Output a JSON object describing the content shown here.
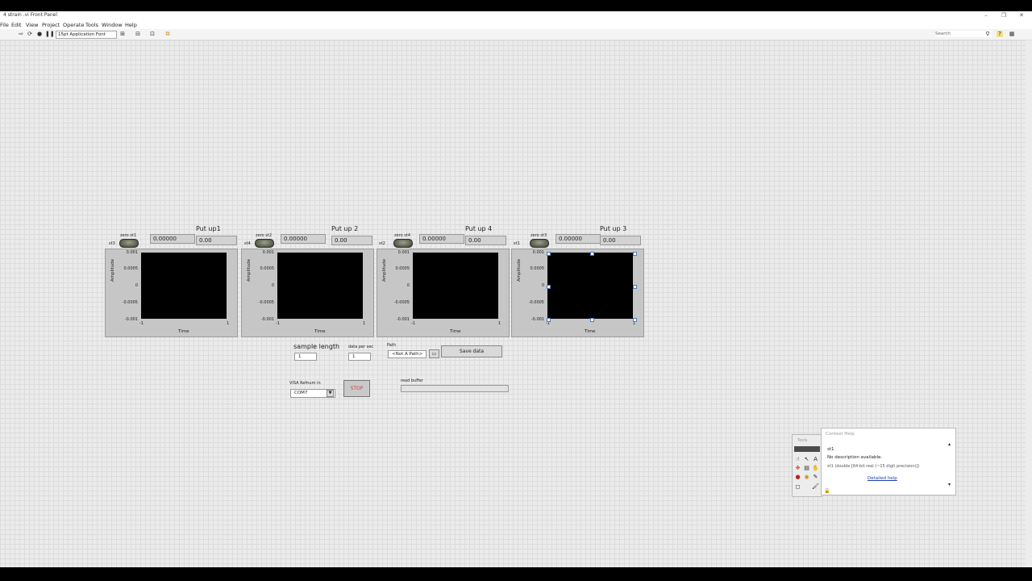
{
  "window": {
    "title": "4 strain .vi Front Panel",
    "minimize_icon": "minimize-icon",
    "restore_icon": "restore-icon",
    "close_icon": "close-icon"
  },
  "menu": [
    "File",
    "Edit",
    "View",
    "Project",
    "Operate",
    "Tools",
    "Window",
    "Help"
  ],
  "toolbar": {
    "font": "15pt Application Font",
    "search_placeholder": "Search",
    "icons": [
      "run-arrow-icon",
      "run-continuously-icon",
      "abort-icon",
      "pause-icon",
      "text-settings-icon",
      "align-icon",
      "distribute-icon",
      "resize-icon",
      "reorder-icon"
    ]
  },
  "panels": [
    {
      "toggle_label": "zero st1",
      "side_label": "st3",
      "reading": "0.00000",
      "title": "Put up1",
      "value": "0.00"
    },
    {
      "toggle_label": "zero st2",
      "side_label": "st4",
      "reading": "0.00000",
      "title": "Put up 2",
      "value": "0.00"
    },
    {
      "toggle_label": "zero st4",
      "side_label": "st2",
      "reading": "0.00000",
      "title": "Put up 4",
      "value": "0.00"
    },
    {
      "toggle_label": "zero st3",
      "side_label": "st1",
      "reading": "0.00000",
      "title": "Put up 3",
      "value": "0.00"
    }
  ],
  "graph_axes": {
    "y_ticks": [
      "0.001",
      "0.0005",
      "0",
      "-0.0005",
      "-0.001"
    ],
    "x_ticks": [
      "-1",
      "1"
    ],
    "ylabel": "Amplitude",
    "xlabel": "Time"
  },
  "controls": {
    "sample_length_label": "sample length",
    "sample_length_value": "1",
    "data_per_sec_label": "data per sec",
    "data_per_sec_value": "1",
    "path_label": "Path",
    "path_value": "<Not A Path>",
    "save_button": "Save data",
    "visa_label": "VISA Refnum in",
    "visa_value": "COM7",
    "stop_button": "STOP",
    "read_buffer_label": "read buffer",
    "read_buffer_value": ""
  },
  "tools_palette": {
    "title": "Tools"
  },
  "context_help": {
    "title": "Context Help",
    "name": "st1",
    "description": "No description available.",
    "type": "st1 (double [64-bit real (~15 digit precision)])",
    "link": "Detailed help"
  }
}
